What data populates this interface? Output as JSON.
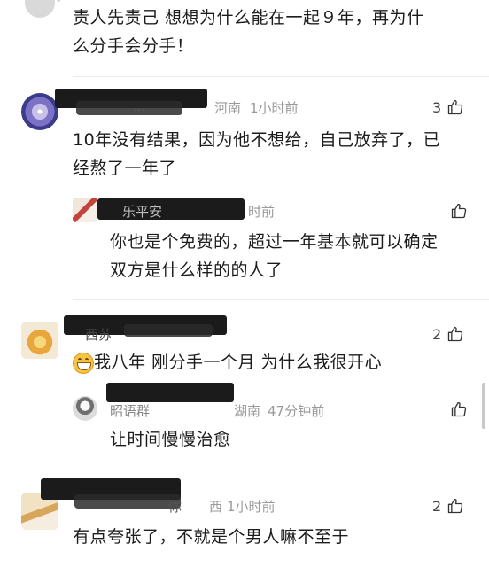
{
  "comments": [
    {
      "text_line1": "责人先责己  想想为什么能在一起９年，再为什",
      "text_line2": "么分手会分手！"
    },
    {
      "username": "...",
      "location": "河南",
      "time": "1小时前",
      "likes": "3",
      "text_line1": "10年没有结果，因为他不想给，自己放弃了，已",
      "text_line2": "经熬了一年了"
    },
    {
      "username": "乐平安",
      "time": "时前",
      "text_line1": "你也是个免费的，超过一年基本就可以确定",
      "text_line2": "双方是什么样的的人了"
    },
    {
      "username": "西苏",
      "likes": "2",
      "text_line1": "我八年 刚分手一个月 为什么我很开心"
    },
    {
      "username": "昭语群",
      "location": "湖南",
      "time": "47分钟前",
      "text_line1": "让时间慢慢治愈"
    },
    {
      "username": "你",
      "location": "西",
      "time": "1小时前",
      "likes": "2",
      "text_line1": "有点夸张了，不就是个男人嘛不至于"
    }
  ],
  "colors": {
    "meta": "#9a9a9a",
    "text": "#1c1c1c",
    "divider": "#ececec"
  }
}
